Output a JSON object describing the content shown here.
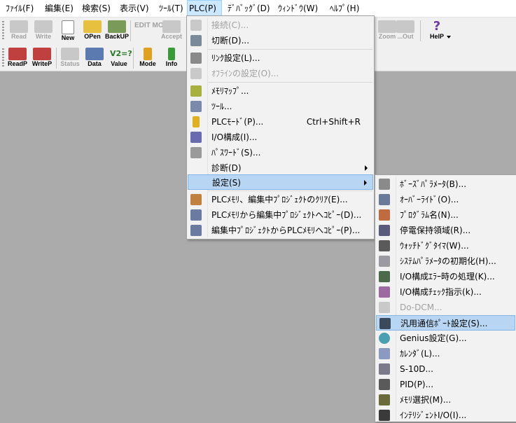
{
  "menubar": {
    "items": [
      "ﾌｧｲﾙ(F)",
      "編集(E)",
      "検索(S)",
      "表示(V)",
      "ﾂｰﾙ(T)",
      "PLC(P)",
      "ﾃﾞﾊﾞｯｸﾞ(D)",
      "ｳｨﾝﾄﾞｳ(W)",
      "ﾍﾙﾌﾟ(H)"
    ]
  },
  "toolbar1": {
    "buttons": [
      "Read",
      "Write",
      "New",
      "OPen",
      "BackUP",
      "EDIT MODE",
      "Accept",
      "Zoom",
      "...Out",
      "HelP"
    ]
  },
  "toolbar2": {
    "buttons": [
      "ReadP",
      "WriteP",
      "Status",
      "Data",
      "Value",
      "Mode",
      "Info"
    ]
  },
  "plc_menu": {
    "items": [
      {
        "label": "接続(C)...",
        "shortcut": ""
      },
      {
        "label": "切断(D)...",
        "shortcut": ""
      },
      {
        "label": "ﾘﾝｸ設定(L)...",
        "shortcut": ""
      },
      {
        "label": "ｵﾌﾗｲﾝの設定(O)...",
        "shortcut": ""
      },
      {
        "label": "ﾒﾓﾘﾏｯﾌﾟ...",
        "shortcut": ""
      },
      {
        "label": "ﾂｰﾙ...",
        "shortcut": ""
      },
      {
        "label": "PLCﾓｰﾄﾞ(P)...",
        "shortcut": "Ctrl+Shift+R"
      },
      {
        "label": "I/O構成(I)...",
        "shortcut": ""
      },
      {
        "label": "ﾊﾟｽﾜｰﾄﾞ(S)...",
        "shortcut": ""
      },
      {
        "label": "診断(D)",
        "shortcut": ""
      },
      {
        "label": "設定(S)",
        "shortcut": ""
      },
      {
        "label": "PLCﾒﾓﾘ、編集中ﾌﾟﾛｼﾞｪｸﾄのｸﾘｱ(E)...",
        "shortcut": ""
      },
      {
        "label": "PLCﾒﾓﾘから編集中ﾌﾟﾛｼﾞｪｸﾄへｺﾋﾟｰ(D)...",
        "shortcut": ""
      },
      {
        "label": "編集中ﾌﾟﾛｼﾞｪｸﾄからPLCﾒﾓﾘへｺﾋﾟｰ(P)...",
        "shortcut": ""
      }
    ]
  },
  "settings_menu": {
    "items": [
      {
        "label": "ﾎﾞｰｽﾞﾊﾟﾗﾒｰﾀ(B)..."
      },
      {
        "label": "ｵｰﾊﾞｰﾗｲﾄﾞ(O)..."
      },
      {
        "label": "ﾌﾟﾛｸﾞﾗﾑ名(N)..."
      },
      {
        "label": "停電保持領域(R)..."
      },
      {
        "label": "ｳｫｯﾁﾄﾞｸﾞﾀｲﾏ(W)..."
      },
      {
        "label": "ｼｽﾃﾑﾊﾟﾗﾒｰﾀの初期化(H)..."
      },
      {
        "label": "I/O構成ｴﾗｰ時の処理(K)..."
      },
      {
        "label": "I/O構成ﾁｪｯｸ指示(k)..."
      },
      {
        "label": "Do-DCM..."
      },
      {
        "label": "汎用通信ﾎﾟｰﾄ設定(S)..."
      },
      {
        "label": "Genius設定(G)..."
      },
      {
        "label": "ｶﾚﾝﾀﾞ(L)..."
      },
      {
        "label": "S-10D..."
      },
      {
        "label": "PID(P)..."
      },
      {
        "label": "ﾒﾓﾘ選択(M)..."
      },
      {
        "label": "ｲﾝﾃﾘｼﾞｪﾝﾄI/O(I)..."
      }
    ]
  }
}
